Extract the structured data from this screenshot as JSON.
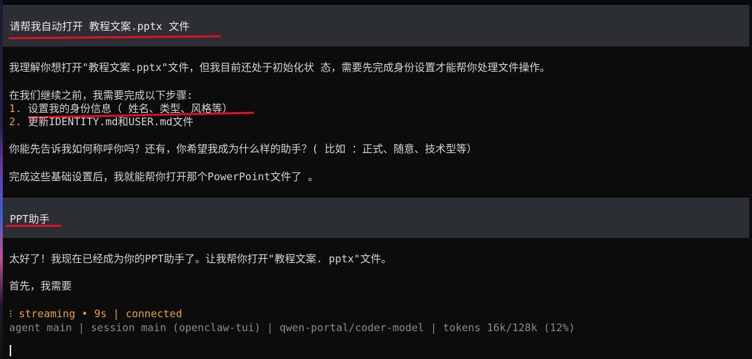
{
  "messages": [
    {
      "role": "user",
      "text": "请帮我自动打开 教程文案.pptx 文件"
    },
    {
      "role": "assistant",
      "lines": {
        "intro": "我理解你想打开\"教程文案.pptx\"文件，但我目前还处于初始化状 态，需要先完成身份设置才能帮你处理文件操作。",
        "steps_header": "在我们继续之前，我需要完成以下步骤:",
        "step1_num": "1.",
        "step1_text": "设置我的身份信息（ 姓名、类型、风格等）",
        "step2_num": "2.",
        "step2_text": "更新IDENTITY.md和USER.md文件",
        "question": "你能先告诉我如何称呼你吗？还有，你希望我成为什么样的助手？( 比如 ：正式、随意、技术型等）",
        "closing": "完成这些基础设置后，我就能帮你打开那个PowerPoint文件了 。"
      }
    },
    {
      "role": "user",
      "text": "PPT助手"
    },
    {
      "role": "assistant",
      "lines": {
        "reply1": "太好了！我现在已经成为你的PPT助手了。让我帮你打开\"教程文案. pptx\"文件。",
        "reply2": "首先，我需要"
      }
    }
  ],
  "status": {
    "spinner": "⁝",
    "state": "streaming",
    "bullet": "•",
    "elapsed": "9s",
    "divider": "|",
    "connection": "connected"
  },
  "footer": {
    "agent": "agent main",
    "session": "session main (openclaw-tui)",
    "model": "qwen-portal/coder-model",
    "tokens": "tokens 16k/128k (12%)",
    "divider": "|"
  },
  "colors": {
    "background": "#0c0c0c",
    "user_block": "#2b2e33",
    "status_accent": "#e6a23c",
    "annotation_red": "#e0102a"
  }
}
